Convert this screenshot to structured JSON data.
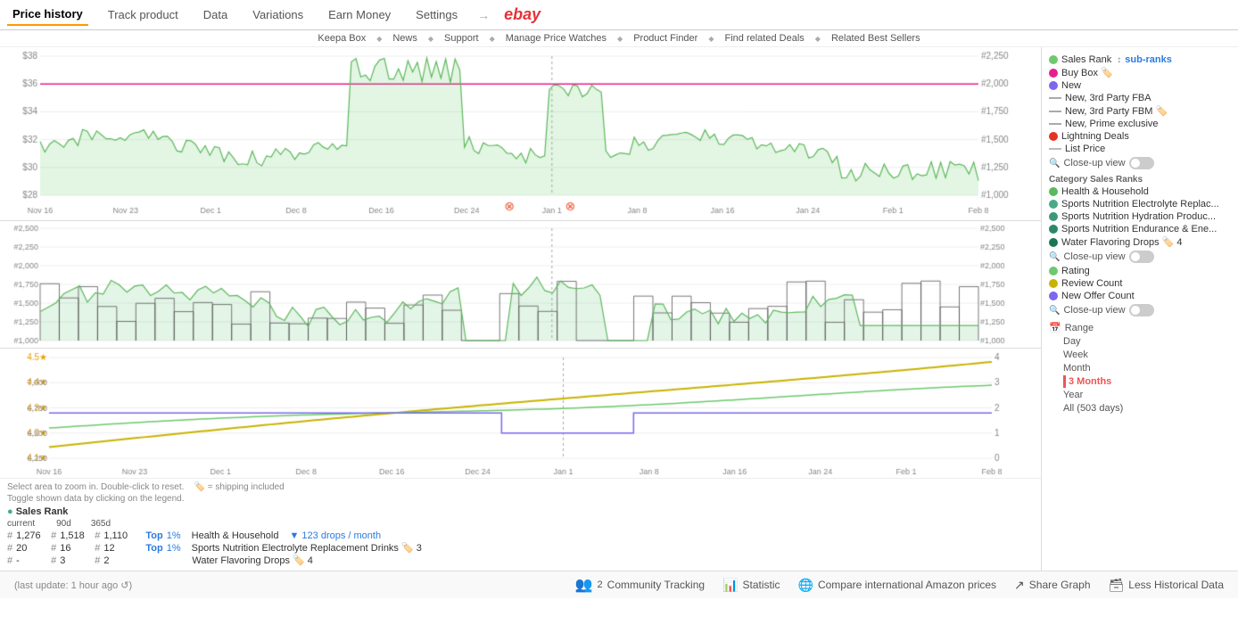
{
  "topNav": {
    "tabs": [
      {
        "label": "Price history",
        "active": true
      },
      {
        "label": "Track product",
        "active": false
      },
      {
        "label": "Data",
        "active": false
      },
      {
        "label": "Variations",
        "active": false
      },
      {
        "label": "Earn Money",
        "active": false
      },
      {
        "label": "Settings",
        "active": false
      }
    ],
    "ebay": "ebay"
  },
  "subNav": {
    "items": [
      "Keepa Box",
      "News",
      "Support",
      "Manage Price Watches",
      "Product Finder",
      "Find related Deals",
      "Related Best Sellers"
    ]
  },
  "sidebar": {
    "legend": [
      {
        "id": "sales-rank",
        "color": "#6dc96d",
        "type": "dot",
        "label": "Sales Rank",
        "extra": "sub-ranks"
      },
      {
        "id": "buy-box",
        "color": "#e91e8c",
        "type": "dot",
        "label": "Buy Box 🏷️"
      },
      {
        "id": "new",
        "color": "#7b68ee",
        "type": "dot",
        "label": "New"
      },
      {
        "id": "new-3p-fba",
        "color": "#aaa",
        "type": "line",
        "label": "New, 3rd Party FBA"
      },
      {
        "id": "new-3p-fbm",
        "color": "#aaa",
        "type": "line",
        "label": "New, 3rd Party FBM 🏷️"
      },
      {
        "id": "new-prime",
        "color": "#aaa",
        "type": "line",
        "label": "New, Prime exclusive"
      },
      {
        "id": "lightning",
        "color": "#e53",
        "type": "dot",
        "label": "Lightning Deals"
      },
      {
        "id": "list-price",
        "color": "#bbb",
        "type": "line",
        "label": "List Price"
      }
    ],
    "closeupView1": "Close-up view",
    "categoryTitle": "Category Sales Ranks",
    "categories": [
      {
        "color": "#5cb85c",
        "label": "Health & Household"
      },
      {
        "color": "#4a9",
        "label": "Sports Nutrition Electrolyte Replac..."
      },
      {
        "color": "#3a8",
        "label": "Sports Nutrition Hydration Produc..."
      },
      {
        "color": "#2a7",
        "label": "Sports Nutrition Endurance & Ene..."
      },
      {
        "color": "#1a6",
        "label": "Water Flavoring Drops 🏷️ 4"
      }
    ],
    "closeupView2": "Close-up view",
    "ratingLegend": [
      {
        "color": "#6dc96d",
        "label": "Rating"
      },
      {
        "color": "#c8b400",
        "label": "Review Count"
      },
      {
        "color": "#7b68ee",
        "label": "New Offer Count"
      }
    ],
    "closeupView3": "Close-up view",
    "rangeLabel": "Range",
    "rangeOptions": [
      {
        "label": "Day",
        "active": false
      },
      {
        "label": "Week",
        "active": false
      },
      {
        "label": "Month",
        "active": false
      },
      {
        "label": "3 Months",
        "active": true
      },
      {
        "label": "Year",
        "active": false
      },
      {
        "label": "All (503 days)",
        "active": false
      }
    ]
  },
  "statsArea": {
    "zoomNote": "Select area to zoom in. Double-click to reset.   🏷️ = shipping included",
    "toggleNote": "Toggle shown data by clicking on the legend.",
    "salesRankLabel": "● Sales Rank",
    "headers": [
      "current",
      "90d",
      "365d"
    ],
    "rows": [
      {
        "hash1": "#",
        "v1": "1,276",
        "hash2": "#",
        "v2": "1,518",
        "hash3": "#",
        "v3": "1,110",
        "top": "Top",
        "pct": "1%",
        "category": "Health & Household",
        "extra": "▼ 123 drops / month"
      },
      {
        "hash1": "#",
        "v1": "20",
        "hash2": "#",
        "v2": "16",
        "hash3": "#",
        "v3": "12",
        "top": "Top",
        "pct": "1%",
        "category": "Sports Nutrition Electrolyte Replacement Drinks 🏷️ 3",
        "extra": ""
      },
      {
        "hash1": "#",
        "v1": "-",
        "hash2": "#",
        "v2": "3",
        "hash3": "#",
        "v3": "2",
        "top": "",
        "pct": "",
        "category": "Water Flavoring Drops 🏷️ 4",
        "extra": ""
      }
    ]
  },
  "bottomBar": {
    "updateInfo": "(last update: 1 hour ago ↺)",
    "trackingCount": "2",
    "actions": [
      {
        "icon": "people",
        "label": "Community Tracking"
      },
      {
        "icon": "bar-chart",
        "label": "Statistic"
      },
      {
        "icon": "globe",
        "label": "Compare international Amazon prices"
      },
      {
        "icon": "share",
        "label": "Share Graph"
      },
      {
        "icon": "data",
        "label": "Less Historical Data"
      }
    ]
  },
  "charts": {
    "xLabels": [
      "Nov 16",
      "Nov 23",
      "Dec 1",
      "Dec 8",
      "Dec 16",
      "Dec 24",
      "Jan 1",
      "Jan 8",
      "Jan 16",
      "Jan 24",
      "Feb 1",
      "Feb 8"
    ],
    "priceYLabels": [
      "$28",
      "$30",
      "$32",
      "$34",
      "$36",
      "$38"
    ],
    "priceY2Labels": [
      "#1,000",
      "#1,250",
      "#1,500",
      "#1,750",
      "#2,000",
      "#2,250"
    ],
    "salesYLabels": [
      "#1,000",
      "#1,250",
      "#1,500",
      "#1,750",
      "#2,000",
      "#2,250",
      "#2,500"
    ],
    "ratingYLeft": [
      "4.1★",
      "4.2★",
      "4.3★",
      "4.4★",
      "4.5★"
    ],
    "ratingYLeftNum": [
      "6,250",
      "6,500",
      "6,750",
      "7,000"
    ],
    "ratingYRight": [
      "0",
      "1",
      "2",
      "3",
      "4"
    ]
  }
}
